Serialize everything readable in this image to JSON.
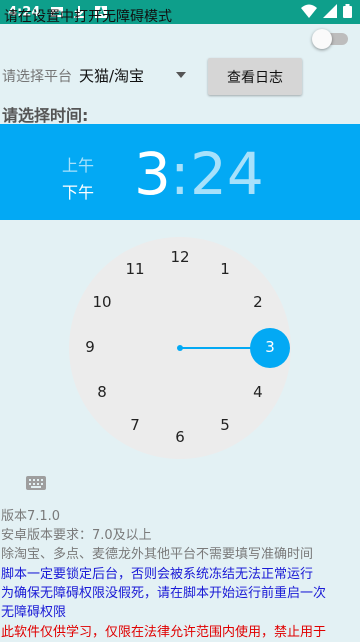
{
  "status_bar": {
    "time": "4:24",
    "icons": [
      "image-icon",
      "download-icon",
      "font-icon",
      "wifi-icon",
      "signal-icon",
      "battery-icon"
    ]
  },
  "accessibility": {
    "prompt": "请在设置中打开无障碍模式",
    "toggle_on": false
  },
  "platform": {
    "label": "请选择平台",
    "selected": "天猫/淘宝"
  },
  "log_button": "查看日志",
  "time_picker": {
    "title": "请选择时间:",
    "am": "上午",
    "pm": "下午",
    "selected_period": "pm",
    "hour": "3",
    "separator": ":",
    "minute": "24",
    "dial_numbers": [
      "12",
      "1",
      "2",
      "3",
      "4",
      "5",
      "6",
      "7",
      "8",
      "9",
      "10",
      "11"
    ],
    "selected_hour": 3,
    "accent": "#03a9f4"
  },
  "info": {
    "version": "版本7.1.0",
    "android_req": "安卓版本要求：7.0及以上",
    "platform_note": "除淘宝、多点、麦德龙外其他平台不需要填写准确时间",
    "warning_1": "脚本一定要锁定后台，否则会被系统冻结无法正常运行",
    "warning_2": "为确保无障碍权限没假死，请在脚本开始运行前重启一次",
    "warning_3": "无障碍权限",
    "legal": "此软件仅供学习，仅限在法律允许范围内使用，禁止用于"
  }
}
